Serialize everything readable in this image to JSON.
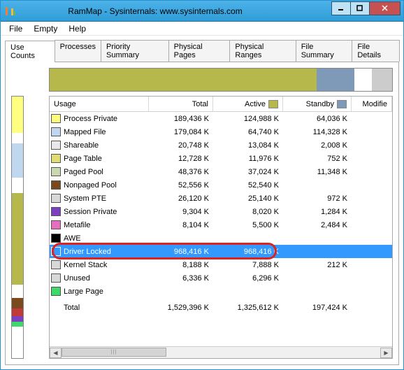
{
  "window": {
    "title": "RamMap - Sysinternals: www.sysinternals.com"
  },
  "menu": [
    "File",
    "Empty",
    "Help"
  ],
  "tabs": [
    "Use Counts",
    "Processes",
    "Priority Summary",
    "Physical Pages",
    "Physical Ranges",
    "File Summary",
    "File Details"
  ],
  "active_tab": 0,
  "columns": {
    "usage": "Usage",
    "total": "Total",
    "active": "Active",
    "standby": "Standby",
    "modified": "Modifie"
  },
  "header_colors": {
    "active": "#b6b84b",
    "standby": "#7f9ab8"
  },
  "rows": [
    {
      "label": "Process Private",
      "color": "#feff80",
      "total": "189,436 K",
      "active": "124,988 K",
      "standby": "64,036 K",
      "modified": "",
      "selected": false
    },
    {
      "label": "Mapped File",
      "color": "#bfd7ef",
      "total": "179,084 K",
      "active": "64,740 K",
      "standby": "114,328 K",
      "modified": "",
      "selected": false
    },
    {
      "label": "Shareable",
      "color": "#e8e8e8",
      "total": "20,748 K",
      "active": "13,084 K",
      "standby": "2,008 K",
      "modified": "",
      "selected": false
    },
    {
      "label": "Page Table",
      "color": "#e0dd77",
      "total": "12,728 K",
      "active": "11,976 K",
      "standby": "752 K",
      "modified": "",
      "selected": false
    },
    {
      "label": "Paged Pool",
      "color": "#c9d8b0",
      "total": "48,376 K",
      "active": "37,024 K",
      "standby": "11,348 K",
      "modified": "",
      "selected": false
    },
    {
      "label": "Nonpaged Pool",
      "color": "#7a4a1e",
      "total": "52,556 K",
      "active": "52,540 K",
      "standby": "",
      "modified": "",
      "selected": false
    },
    {
      "label": "System PTE",
      "color": "#d8d8d8",
      "total": "26,120 K",
      "active": "25,140 K",
      "standby": "972 K",
      "modified": "",
      "selected": false
    },
    {
      "label": "Session Private",
      "color": "#7b3fbf",
      "total": "9,304 K",
      "active": "8,020 K",
      "standby": "1,284 K",
      "modified": "",
      "selected": false
    },
    {
      "label": "Metafile",
      "color": "#e56fbf",
      "total": "8,104 K",
      "active": "5,500 K",
      "standby": "2,484 K",
      "modified": "",
      "selected": false
    },
    {
      "label": "AWE",
      "color": "#000000",
      "total": "",
      "active": "",
      "standby": "",
      "modified": "",
      "selected": false
    },
    {
      "label": "Driver Locked",
      "color": "#3399ff",
      "total": "968,416 K",
      "active": "968,416 K",
      "standby": "",
      "modified": "",
      "selected": true
    },
    {
      "label": "Kernel Stack",
      "color": "#d8d8d8",
      "total": "8,188 K",
      "active": "7,888 K",
      "standby": "212 K",
      "modified": "",
      "selected": false
    },
    {
      "label": "Unused",
      "color": "#d8d8d8",
      "total": "6,336 K",
      "active": "6,296 K",
      "standby": "",
      "modified": "",
      "selected": false
    },
    {
      "label": "Large Page",
      "color": "#3fd96b",
      "total": "",
      "active": "",
      "standby": "",
      "modified": "",
      "selected": false
    }
  ],
  "total_row": {
    "label": "Total",
    "total": "1,529,396 K",
    "active": "1,325,612 K",
    "standby": "197,424 K",
    "modified": ""
  },
  "highlight_row_index": 10,
  "topbar_segments": [
    {
      "color": "#b6b84b",
      "width": 78
    },
    {
      "color": "#7f9ab8",
      "width": 11
    },
    {
      "color": "#ffffff",
      "width": 5
    },
    {
      "color": "#cccccc",
      "width": 6
    }
  ],
  "vstrip_segments": [
    {
      "color": "#feff80",
      "height": 14
    },
    {
      "color": "#ffffff",
      "height": 4
    },
    {
      "color": "#bfd7ef",
      "height": 13
    },
    {
      "color": "#ffffff",
      "height": 6
    },
    {
      "color": "#b6b84b",
      "height": 35
    },
    {
      "color": "#ffffff",
      "height": 5
    },
    {
      "color": "#7a4a1e",
      "height": 4
    },
    {
      "color": "#c13a3a",
      "height": 3
    },
    {
      "color": "#7b3fbf",
      "height": 2
    },
    {
      "color": "#3fd96b",
      "height": 2
    },
    {
      "color": "#ffffff",
      "height": 12
    }
  ],
  "chart_data": {
    "type": "table",
    "title": "RamMap Use Counts",
    "columns": [
      "Usage",
      "Total (K)",
      "Active (K)",
      "Standby (K)"
    ],
    "rows": [
      [
        "Process Private",
        189436,
        124988,
        64036
      ],
      [
        "Mapped File",
        179084,
        64740,
        114328
      ],
      [
        "Shareable",
        20748,
        13084,
        2008
      ],
      [
        "Page Table",
        12728,
        11976,
        752
      ],
      [
        "Paged Pool",
        48376,
        37024,
        11348
      ],
      [
        "Nonpaged Pool",
        52556,
        52540,
        null
      ],
      [
        "System PTE",
        26120,
        25140,
        972
      ],
      [
        "Session Private",
        9304,
        8020,
        1284
      ],
      [
        "Metafile",
        8104,
        5500,
        2484
      ],
      [
        "AWE",
        null,
        null,
        null
      ],
      [
        "Driver Locked",
        968416,
        968416,
        null
      ],
      [
        "Kernel Stack",
        8188,
        7888,
        212
      ],
      [
        "Unused",
        6336,
        6296,
        null
      ],
      [
        "Large Page",
        null,
        null,
        null
      ],
      [
        "Total",
        1529396,
        1325612,
        197424
      ]
    ]
  }
}
